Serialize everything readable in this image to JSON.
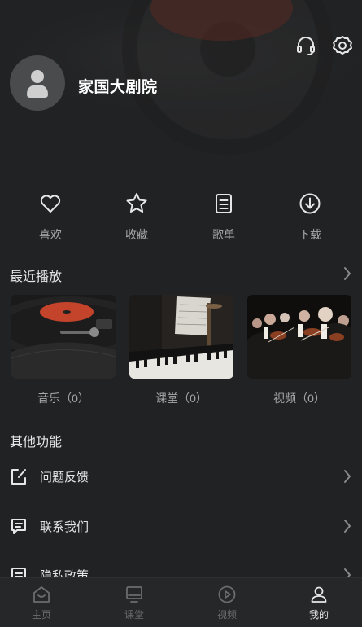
{
  "header": {
    "user_name": "家国大剧院",
    "icons": [
      "headset-icon",
      "gear-icon"
    ]
  },
  "quick_actions": [
    {
      "label": "喜欢",
      "icon": "heart-icon"
    },
    {
      "label": "收藏",
      "icon": "star-icon"
    },
    {
      "label": "歌单",
      "icon": "playlist-icon"
    },
    {
      "label": "下载",
      "icon": "download-icon"
    }
  ],
  "recent": {
    "title": "最近播放",
    "items": [
      {
        "label": "音乐（0）",
        "image": "vinyl-record-photo"
      },
      {
        "label": "课堂（0）",
        "image": "piano-sheet-music-photo"
      },
      {
        "label": "视频（0）",
        "image": "orchestra-photo"
      }
    ]
  },
  "other": {
    "title": "其他功能",
    "items": [
      {
        "label": "问题反馈",
        "icon": "edit-icon"
      },
      {
        "label": "联系我们",
        "icon": "message-icon"
      },
      {
        "label": "隐私政策",
        "icon": "document-icon"
      }
    ]
  },
  "tabs": [
    {
      "label": "主页",
      "icon": "home-icon"
    },
    {
      "label": "课堂",
      "icon": "monitor-icon"
    },
    {
      "label": "视频",
      "icon": "play-icon"
    },
    {
      "label": "我的",
      "icon": "user-icon",
      "active": true
    }
  ],
  "colors": {
    "background": "#202224",
    "text": "#e6e6e6",
    "muted": "#a7a7a7",
    "tab_inactive": "#6b6c6e"
  }
}
